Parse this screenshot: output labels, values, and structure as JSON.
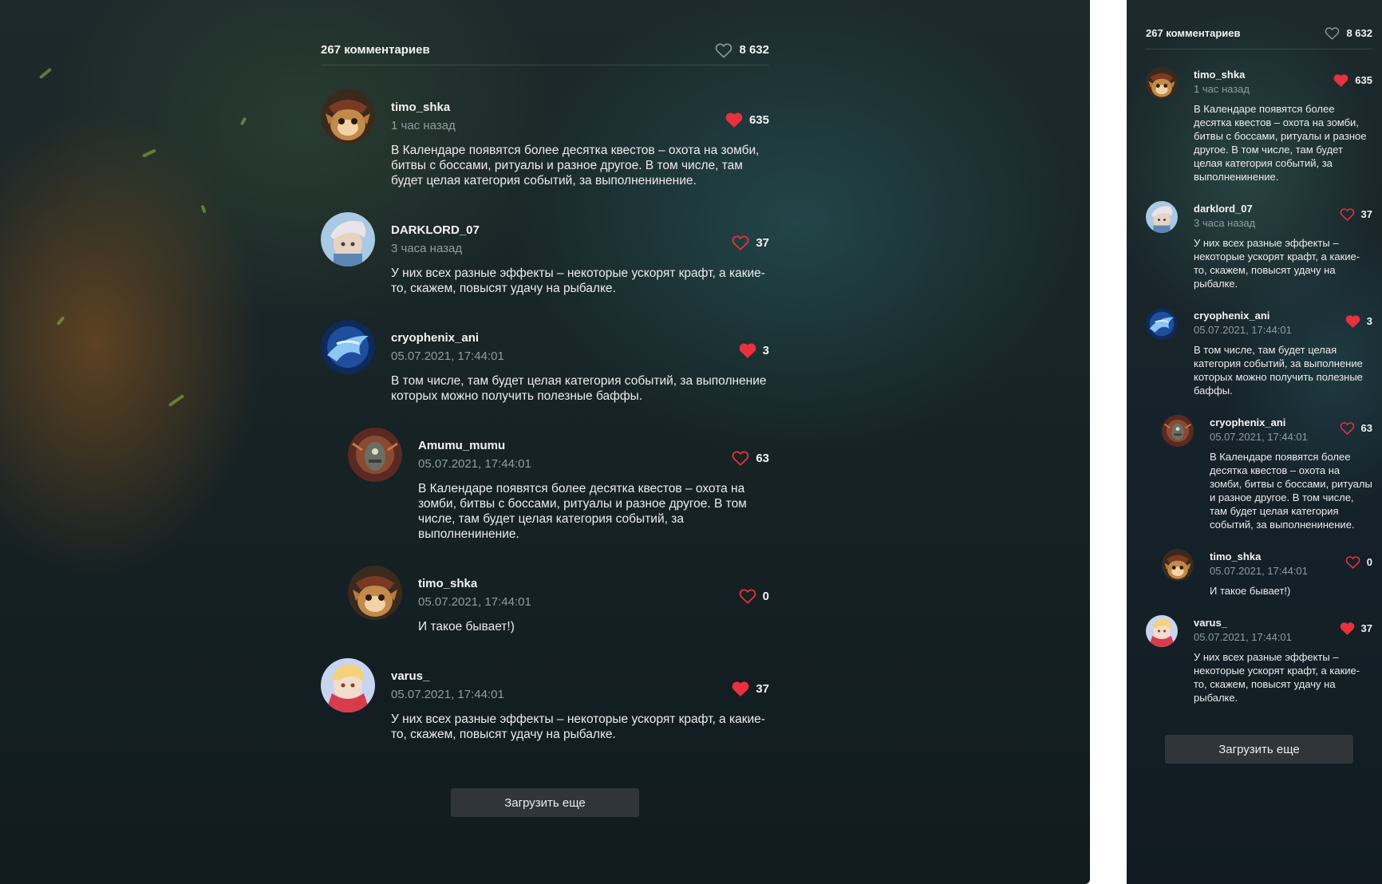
{
  "header": {
    "comments_count": "267 комментариев",
    "likes_count": "8 632"
  },
  "colors": {
    "heart_active": "#e8313c",
    "heart_outline": "#e8313c",
    "header_heart_outline": "#8c9aa0"
  },
  "desktop": {
    "comments": [
      {
        "author": "timo_shka",
        "time": "1 час назад",
        "likes": "635",
        "liked": true,
        "avatar": "teemo-avatar",
        "reply": false,
        "text": "В Календаре появятся более десятка квестов – охота на зомби, битвы с боссами, ритуалы и разное другое. В том числе, там будет целая категория событий, за выполненинение."
      },
      {
        "author": "DARKLORD_07",
        "time": "3 часа назад",
        "likes": "37",
        "liked": false,
        "avatar": "champion-avatar",
        "reply": false,
        "text": "У них всех разные эффекты – некоторые ускорят крафт, а какие-то, скажем, повысят удачу на рыбалке."
      },
      {
        "author": "cryophenix_ani",
        "time": "05.07.2021, 17:44:01",
        "likes": "3",
        "liked": true,
        "avatar": "phoenix-avatar",
        "reply": false,
        "text": "В том числе, там будет целая категория событий, за выполнение которых можно получить полезные баффы."
      },
      {
        "author": "Amumu_mumu",
        "time": "05.07.2021, 17:44:01",
        "likes": "63",
        "liked": false,
        "avatar": "amumu-avatar",
        "reply": true,
        "text": "В Календаре появятся более десятка квестов – охота на зомби, битвы с боссами, ритуалы и разное другое. В том числе, там будет целая категория событий, за выполненинение."
      },
      {
        "author": "timo_shka",
        "time": "05.07.2021, 17:44:01",
        "likes": "0",
        "liked": false,
        "avatar": "teemo-avatar",
        "reply": true,
        "text": "И такое бывает!)"
      },
      {
        "author": "varus_",
        "time": "05.07.2021, 17:44:01",
        "likes": "37",
        "liked": true,
        "avatar": "varus-avatar",
        "reply": false,
        "text": "У них всех разные эффекты – некоторые ускорят крафт, а какие-то, скажем, повысят удачу на рыбалке."
      }
    ],
    "load_more": "Загрузить еще"
  },
  "mobile": {
    "comments": [
      {
        "author": "timo_shka",
        "time": "1 час назад",
        "likes": "635",
        "liked": true,
        "avatar": "teemo-avatar",
        "reply": false,
        "text": "В Календаре появятся более десятка квестов – охота на зомби, битвы с боссами, ритуалы и разное другое. В том числе, там будет целая категория событий, за выполненинение."
      },
      {
        "author": "darklord_07",
        "time": "3 часа назад",
        "likes": "37",
        "liked": false,
        "avatar": "champion-avatar",
        "reply": false,
        "text": "У них всех разные эффекты – некоторые ускорят крафт, а какие-то, скажем, повысят удачу на рыбалке."
      },
      {
        "author": "cryophenix_ani",
        "time": "05.07.2021, 17:44:01",
        "likes": "3",
        "liked": true,
        "avatar": "phoenix-avatar",
        "reply": false,
        "text": "В том числе, там будет целая категория событий, за выполнение которых можно получить полезные баффы."
      },
      {
        "author": "cryophenix_ani",
        "time": "05.07.2021, 17:44:01",
        "likes": "63",
        "liked": false,
        "avatar": "amumu-avatar",
        "reply": true,
        "text": "В Календаре появятся более десятка квестов – охота на зомби, битвы с боссами, ритуалы и разное другое. В том числе, там будет целая категория событий, за выполненинение."
      },
      {
        "author": "timo_shka",
        "time": "05.07.2021, 17:44:01",
        "likes": "0",
        "liked": false,
        "avatar": "teemo-avatar",
        "reply": true,
        "text": "И такое бывает!)"
      },
      {
        "author": "varus_",
        "time": "05.07.2021, 17:44:01",
        "likes": "37",
        "liked": true,
        "avatar": "varus-avatar",
        "reply": false,
        "text": "У них всех разные эффекты – некоторые ускорят крафт, а какие-то, скажем, повысят удачу на рыбалке."
      }
    ],
    "load_more": "Загрузить еще"
  }
}
